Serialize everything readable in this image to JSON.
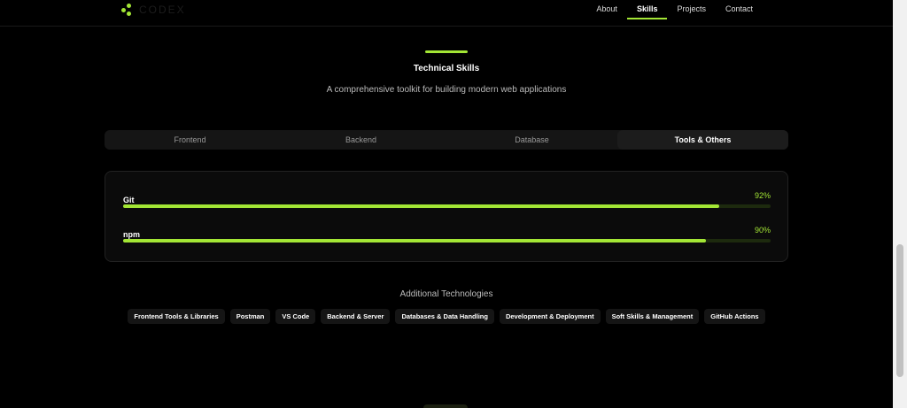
{
  "brand": {
    "name": "CODEX",
    "accent": "#a3e635"
  },
  "nav": [
    "About",
    "Skills",
    "Projects",
    "Contact"
  ],
  "header": {
    "title": "Technical Skills",
    "subtitle": "A comprehensive toolkit for building modern web applications"
  },
  "tabs": [
    "Frontend",
    "Backend",
    "Database",
    "Tools & Others"
  ],
  "skills": [
    {
      "name": "Git",
      "percent": "92%",
      "value": 92
    },
    {
      "name": "npm",
      "percent": "90%",
      "value": 90
    }
  ],
  "additional": {
    "title": "Additional Technologies",
    "items": [
      "Frontend Tools & Libraries",
      "Postman",
      "VS Code",
      "Backend & Server",
      "Databases & Data Handling",
      "Development & Deployment",
      "Soft Skills & Management",
      "GitHub Actions"
    ]
  }
}
